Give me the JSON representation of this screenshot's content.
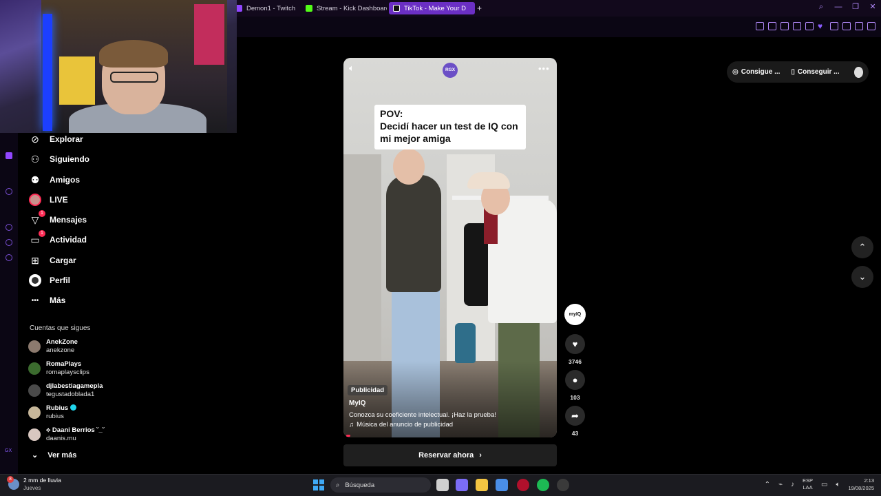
{
  "browser": {
    "tabs": [
      {
        "label": "Demon1 - Twitch",
        "color": "#9146ff"
      },
      {
        "label": "Stream - Kick Dashboard",
        "color": "#53fc18"
      },
      {
        "label": "TikTok - Make Your D",
        "color": "#ffffff",
        "active": true
      }
    ],
    "new_tab": "+",
    "window_controls": [
      "search-icon",
      "minimize-icon",
      "restore-icon",
      "close-icon"
    ],
    "extension_icons": [
      "bookmark-icon",
      "screenshot-icon",
      "shield-icon",
      "translate-icon",
      "play-icon",
      "heart-icon",
      "extensions-icon",
      "profile-icon",
      "download-icon",
      "menu-icon"
    ]
  },
  "sidebar": {
    "nav": [
      {
        "label": "Explorar",
        "icon": "compass-icon",
        "glyph": "⊘"
      },
      {
        "label": "Siguiendo",
        "icon": "following-icon",
        "glyph": "⚇"
      },
      {
        "label": "Amigos",
        "icon": "friends-icon",
        "glyph": "⚉"
      },
      {
        "label": "LIVE",
        "icon": "live-icon",
        "glyph": ""
      },
      {
        "label": "Mensajes",
        "icon": "messages-icon",
        "glyph": "▽",
        "badge": "1"
      },
      {
        "label": "Actividad",
        "icon": "activity-icon",
        "glyph": "▭",
        "badge": "1"
      },
      {
        "label": "Cargar",
        "icon": "upload-icon",
        "glyph": "⊞"
      },
      {
        "label": "Perfil",
        "icon": "profile-icon",
        "glyph": ""
      },
      {
        "label": "Más",
        "icon": "more-icon",
        "glyph": "•••"
      }
    ],
    "following_title": "Cuentas que sigues",
    "accounts": [
      {
        "name": "AnekZone",
        "handle": "anekzone",
        "avatar_color": "#8c7a6e"
      },
      {
        "name": "RomaPlays",
        "handle": "romaplaysclips",
        "avatar_color": "#3b6b2e"
      },
      {
        "name": "djlabestiagamepla",
        "handle": "tegustadoblada1",
        "avatar_color": "#4a4a4a"
      },
      {
        "name": "Rubius",
        "handle": "rubius",
        "avatar_color": "#c7b79a",
        "verified": true
      },
      {
        "name": "⟡ Daani Berrios ˘_˘",
        "handle": "daanis.mu",
        "avatar_color": "#d8c7c0"
      }
    ],
    "see_more": "Ver más",
    "rail_label": "GX"
  },
  "video": {
    "caption": "POV:\nDecidí hacer un test de IQ con mi mejor amiga",
    "badge": "RGX",
    "ad_label": "Publicidad",
    "author": "MyIQ",
    "description": "Conozca su coeficiente intelectual. ¡Haz la prueba!",
    "music": "Música del anuncio de publicidad",
    "progress": 0.02,
    "cta": "Reservar ahora",
    "creator_avatar_text": "myIQ",
    "actions": [
      {
        "icon": "heart-icon",
        "glyph": "♥",
        "count": "3746"
      },
      {
        "icon": "comment-icon",
        "glyph": "●",
        "count": "103"
      },
      {
        "icon": "share-icon",
        "glyph": "➦",
        "count": "43"
      }
    ]
  },
  "topright": {
    "button1": "Consigue ...",
    "button2": "Conseguir ..."
  },
  "taskbar": {
    "weather_line1": "2 mm de lluvia",
    "weather_line2": "Jueves",
    "weather_badge": "8",
    "search_placeholder": "Búsqueda",
    "lang_line1": "ESP",
    "lang_line2": "LAA",
    "time": "2:13",
    "date": "19/08/2025",
    "apps": [
      {
        "name": "task-view-icon",
        "color": "#cfcfcf"
      },
      {
        "name": "copilot-icon",
        "color": "#7b6cf6"
      },
      {
        "name": "file-explorer-icon",
        "color": "#f4c542"
      },
      {
        "name": "store-icon",
        "color": "#4a8ee8"
      },
      {
        "name": "opera-gx-icon",
        "color": "#b0102c"
      },
      {
        "name": "spotify-icon",
        "color": "#1db954"
      },
      {
        "name": "obs-icon",
        "color": "#3a3a3a"
      }
    ]
  }
}
